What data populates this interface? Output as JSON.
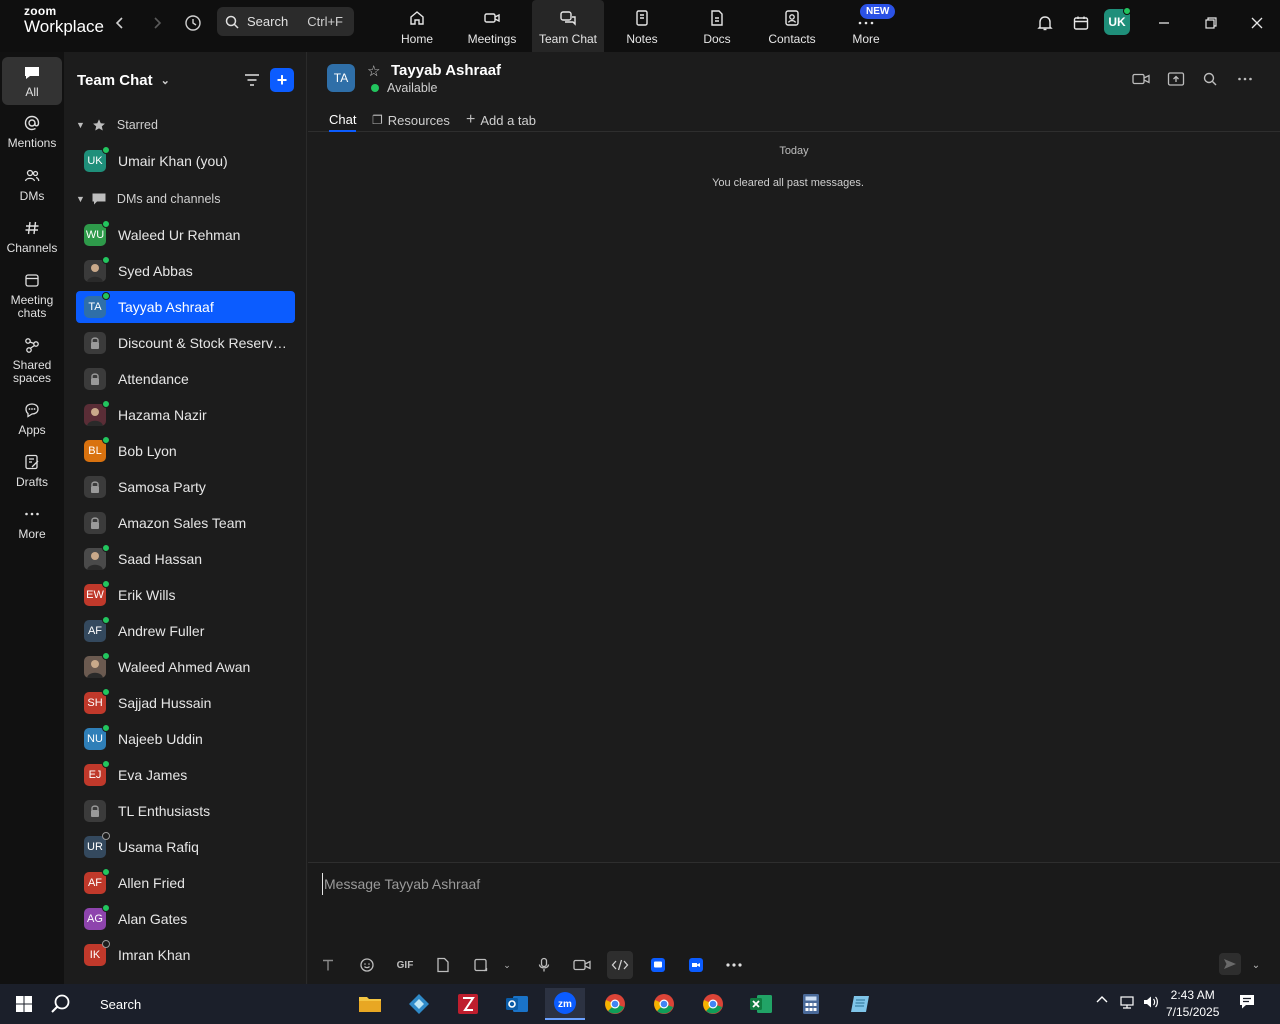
{
  "app": {
    "logo_line1": "zoom",
    "logo_line2": "Workplace"
  },
  "search": {
    "label": "Search",
    "shortcut": "Ctrl+F"
  },
  "nav": [
    {
      "label": "Home",
      "icon": "home-icon"
    },
    {
      "label": "Meetings",
      "icon": "video-icon"
    },
    {
      "label": "Team Chat",
      "icon": "chat-icon"
    },
    {
      "label": "Notes",
      "icon": "notes-icon"
    },
    {
      "label": "Docs",
      "icon": "docs-icon"
    },
    {
      "label": "Contacts",
      "icon": "contacts-icon"
    },
    {
      "label": "More",
      "icon": "more-icon"
    }
  ],
  "new_badge": "NEW",
  "user": {
    "initials": "UK",
    "status_color": "#22c55e"
  },
  "rail": [
    {
      "label": "All"
    },
    {
      "label": "Mentions"
    },
    {
      "label": "DMs"
    },
    {
      "label": "Channels"
    },
    {
      "label": "Meeting chats"
    },
    {
      "label": "Shared spaces"
    },
    {
      "label": "Apps"
    },
    {
      "label": "Drafts"
    },
    {
      "label": "More"
    }
  ],
  "sidebar": {
    "title": "Team Chat",
    "sections": {
      "starred": "Starred",
      "dms": "DMs and channels"
    },
    "starred": [
      {
        "name": "Umair Khan (you)",
        "initials": "UK",
        "color": "#1f8f7a",
        "status": "online"
      }
    ],
    "items": [
      {
        "name": "Waleed Ur Rehman",
        "initials": "WU",
        "color": "#2e9a4a",
        "status": "online"
      },
      {
        "name": "Syed Abbas",
        "initials": "",
        "color": "#3a3a3a",
        "status": "online",
        "photo": true
      },
      {
        "name": "Tayyab Ashraaf",
        "initials": "TA",
        "color": "#2f6fa8",
        "status": "online",
        "active": true
      },
      {
        "name": "Discount & Stock Reservati...",
        "initials": "",
        "color": "#3b3b3b",
        "status": "none",
        "lock": true
      },
      {
        "name": "Attendance",
        "initials": "",
        "color": "#3b3b3b",
        "status": "none",
        "lock": true
      },
      {
        "name": "Hazama Nazir",
        "initials": "",
        "color": "#5a2d36",
        "status": "online",
        "photo": true
      },
      {
        "name": "Bob Lyon",
        "initials": "BL",
        "color": "#d9720f",
        "status": "online"
      },
      {
        "name": "Samosa Party",
        "initials": "",
        "color": "#3b3b3b",
        "status": "none",
        "lock": true
      },
      {
        "name": "Amazon Sales Team",
        "initials": "",
        "color": "#3b3b3b",
        "status": "none",
        "lock": true
      },
      {
        "name": "Saad Hassan",
        "initials": "",
        "color": "#4a4a4a",
        "status": "online",
        "photo": true
      },
      {
        "name": "Erik Wills",
        "initials": "EW",
        "color": "#c0392b",
        "status": "online"
      },
      {
        "name": "Andrew Fuller",
        "initials": "AF",
        "color": "#34495e",
        "status": "online"
      },
      {
        "name": "Waleed Ahmed Awan",
        "initials": "",
        "color": "#6b5a50",
        "status": "online",
        "photo": true
      },
      {
        "name": "Sajjad Hussain",
        "initials": "SH",
        "color": "#c0392b",
        "status": "online"
      },
      {
        "name": "Najeeb Uddin",
        "initials": "NU",
        "color": "#2f7fb8",
        "status": "online"
      },
      {
        "name": "Eva James",
        "initials": "EJ",
        "color": "#c0392b",
        "status": "online"
      },
      {
        "name": "TL Enthusiasts",
        "initials": "",
        "color": "#3b3b3b",
        "status": "none",
        "lock": true
      },
      {
        "name": "Usama Rafiq",
        "initials": "UR",
        "color": "#34495e",
        "status": "away"
      },
      {
        "name": "Allen Fried",
        "initials": "AF",
        "color": "#c0392b",
        "status": "online"
      },
      {
        "name": "Alan Gates",
        "initials": "AG",
        "color": "#8e44ad",
        "status": "online"
      },
      {
        "name": "Imran Khan",
        "initials": "IK",
        "color": "#c0392b",
        "status": "away"
      }
    ]
  },
  "chat": {
    "initials": "TA",
    "name": "Tayyab Ashraaf",
    "status": "Available",
    "tabs": {
      "chat": "Chat",
      "resources": "Resources",
      "add": "Add a tab"
    },
    "today": "Today",
    "cleared": "You cleared all past messages.",
    "placeholder": "Message Tayyab Ashraaf",
    "gif_label": "GIF"
  },
  "taskbar": {
    "search": "Search",
    "time": "2:43 AM",
    "date": "7/15/2025"
  }
}
